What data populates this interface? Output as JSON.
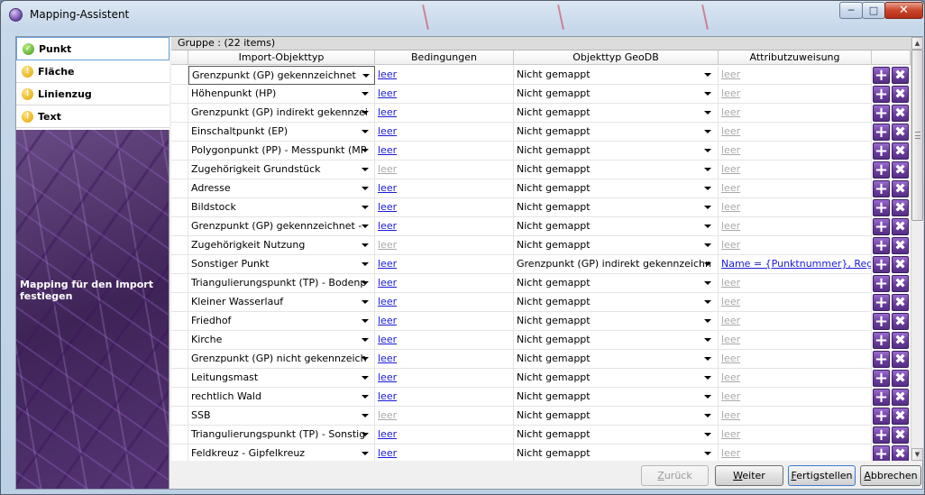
{
  "window": {
    "title": "Mapping-Assistent"
  },
  "nav": {
    "items": [
      {
        "label": "Punkt",
        "status": "ok",
        "icon": "checkmark-icon"
      },
      {
        "label": "Fläche",
        "status": "warning",
        "icon": "warning-icon"
      },
      {
        "label": "Linienzug",
        "status": "warning",
        "icon": "warning-icon"
      },
      {
        "label": "Text",
        "status": "warning",
        "icon": "warning-icon"
      }
    ],
    "caption": "Mapping für den Import festlegen"
  },
  "grid": {
    "group_label": "Gruppe :  (22 items)",
    "columns": {
      "import": "Import-Objekttyp",
      "cond": "Bedingungen",
      "geodb": "Objekttyp GeoDB",
      "attr": "Attributzuweisung"
    },
    "rows": [
      {
        "import": "Grenzpunkt (GP) gekennzeichnet",
        "cond": "leer",
        "cond_active": true,
        "geodb": "Nicht gemappt",
        "attr": "leer",
        "attr_active": false
      },
      {
        "import": "Höhenpunkt (HP)",
        "cond": "leer",
        "cond_active": true,
        "geodb": "Nicht gemappt",
        "attr": "leer",
        "attr_active": false
      },
      {
        "import": "Grenzpunkt (GP) indirekt gekennzei",
        "cond": "leer",
        "cond_active": true,
        "geodb": "Nicht gemappt",
        "attr": "leer",
        "attr_active": false
      },
      {
        "import": "Einschaltpunkt (EP)",
        "cond": "leer",
        "cond_active": true,
        "geodb": "Nicht gemappt",
        "attr": "leer",
        "attr_active": false
      },
      {
        "import": "Polygonpunkt (PP) - Messpunkt (MP",
        "cond": "leer",
        "cond_active": true,
        "geodb": "Nicht gemappt",
        "attr": "leer",
        "attr_active": false
      },
      {
        "import": "Zugehörigkeit Grundstück",
        "cond": "leer",
        "cond_active": false,
        "geodb": "Nicht gemappt",
        "attr": "leer",
        "attr_active": false
      },
      {
        "import": "Adresse",
        "cond": "leer",
        "cond_active": true,
        "geodb": "Nicht gemappt",
        "attr": "leer",
        "attr_active": false
      },
      {
        "import": "Bildstock",
        "cond": "leer",
        "cond_active": true,
        "geodb": "Nicht gemappt",
        "attr": "leer",
        "attr_active": false
      },
      {
        "import": "Grenzpunkt (GP) gekennzeichnet -",
        "cond": "leer",
        "cond_active": true,
        "geodb": "Nicht gemappt",
        "attr": "leer",
        "attr_active": false
      },
      {
        "import": "Zugehörigkeit Nutzung",
        "cond": "leer",
        "cond_active": false,
        "geodb": "Nicht gemappt",
        "attr": "leer",
        "attr_active": false
      },
      {
        "import": "Sonstiger Punkt",
        "cond": "leer",
        "cond_active": true,
        "geodb": "Grenzpunkt (GP) indirekt gekennzeichn",
        "attr": "Name = {Punktnummer}, Region",
        "attr_active": true
      },
      {
        "import": "Triangulierungspunkt (TP) - Bodenp",
        "cond": "leer",
        "cond_active": true,
        "geodb": "Nicht gemappt",
        "attr": "leer",
        "attr_active": false
      },
      {
        "import": "Kleiner Wasserlauf",
        "cond": "leer",
        "cond_active": true,
        "geodb": "Nicht gemappt",
        "attr": "leer",
        "attr_active": false
      },
      {
        "import": "Friedhof",
        "cond": "leer",
        "cond_active": true,
        "geodb": "Nicht gemappt",
        "attr": "leer",
        "attr_active": false
      },
      {
        "import": "Kirche",
        "cond": "leer",
        "cond_active": true,
        "geodb": "Nicht gemappt",
        "attr": "leer",
        "attr_active": false
      },
      {
        "import": "Grenzpunkt (GP) nicht gekennzeich",
        "cond": "leer",
        "cond_active": true,
        "geodb": "Nicht gemappt",
        "attr": "leer",
        "attr_active": false
      },
      {
        "import": "Leitungsmast",
        "cond": "leer",
        "cond_active": true,
        "geodb": "Nicht gemappt",
        "attr": "leer",
        "attr_active": false
      },
      {
        "import": "rechtlich Wald",
        "cond": "leer",
        "cond_active": true,
        "geodb": "Nicht gemappt",
        "attr": "leer",
        "attr_active": false
      },
      {
        "import": "SSB",
        "cond": "leer",
        "cond_active": false,
        "geodb": "Nicht gemappt",
        "attr": "leer",
        "attr_active": false
      },
      {
        "import": "Triangulierungspunkt (TP) - Sonstig",
        "cond": "leer",
        "cond_active": true,
        "geodb": "Nicht gemappt",
        "attr": "leer",
        "attr_active": false
      },
      {
        "import": "Feldkreuz - Gipfelkreuz",
        "cond": "leer",
        "cond_active": true,
        "geodb": "Nicht gemappt",
        "attr": "leer",
        "attr_active": false
      }
    ]
  },
  "buttons": {
    "back": {
      "prefix": "",
      "ul": "Z",
      "rest": "urück"
    },
    "next": {
      "prefix": "",
      "ul": "W",
      "rest": "eiter"
    },
    "finish": {
      "prefix": "",
      "ul": "F",
      "rest": "ertigstellen"
    },
    "cancel": {
      "prefix": "",
      "ul": "A",
      "rest": "bbrechen"
    }
  },
  "colors": {
    "accent_purple": "#6b3d9e",
    "link_blue": "#1a1adc",
    "disabled_gray": "#a9a9a9"
  }
}
